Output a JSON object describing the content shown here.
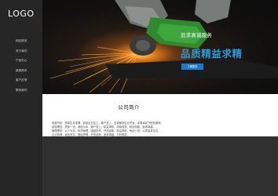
{
  "logo": "LOGO",
  "nav": {
    "items": [
      "网站首页",
      "关于我们",
      "产品中心",
      "新闻资讯",
      "客户反馈",
      "联系我们"
    ]
  },
  "hero": {
    "subtitle": "追求真诚服务",
    "title": "品质精益求精",
    "button_label": "了解更多"
  },
  "about": {
    "title": "公司简介",
    "lines": [
      "经营宗旨：质量生存发展，诚信企业至上，客户至上，至诚服务企业宗旨，本着诚实守信的原则。",
      "经营理念：质量一流，诚信为本，客户至上，精益求精，持续改进，科技创新，追求卓越。",
      "管理理念：以人为本，科学管理，团结协作，开拓创新，精益求精，争创一流，以质量求生存。",
      "企业精神：诚信务实，团结拼搏，开拓创新，追求卓越，与时俱进。",
      "十年风雨兼程，我们始终秉承“质量第一、信誉至上”的经营理念，以精湛的技术和完善的服务赢得客户的信赖与支持，产品远销国内外市场。",
      "公司拥有先进的生产设备和检测仪器，技术力量雄厚，我们将一如既往地为广大客户提供优质的产品和服务，欢迎新老客户莅临指导。"
    ]
  },
  "colors": {
    "accent": "#2b9ad8",
    "button": "#1e79c7",
    "sidebar": "#262626",
    "footer": "#303030"
  },
  "icons": [
    "angle-grinder-photo"
  ]
}
